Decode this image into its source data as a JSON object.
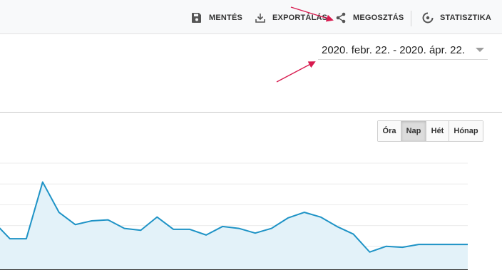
{
  "toolbar": {
    "items": [
      {
        "label": "MENTÉS",
        "icon": "save-icon"
      },
      {
        "label": "EXPORTÁLÁS",
        "icon": "download-icon"
      },
      {
        "label": "MEGOSZTÁS",
        "icon": "share-icon"
      },
      {
        "label": "STATISZTIKA",
        "icon": "insights-icon"
      }
    ]
  },
  "date_range": {
    "text": "2020. febr. 22. - 2020. ápr. 22."
  },
  "granularity": {
    "buttons": [
      "Óra",
      "Nap",
      "Hét",
      "Hónap"
    ],
    "selected": "Nap"
  },
  "colors": {
    "line": "#1e93c6",
    "area": "#e3f2f9",
    "annotation_arrow": "#d81b4f"
  },
  "chart_data": {
    "type": "area",
    "x": [
      1,
      2,
      3,
      4,
      5,
      6,
      7,
      8,
      9,
      10,
      11,
      12,
      13,
      14,
      15,
      16,
      17,
      18,
      19,
      20,
      21,
      22,
      23,
      24,
      25,
      26,
      27,
      28,
      29,
      30
    ],
    "series": [
      {
        "values": [
          48,
          30,
          30,
          90,
          58,
          45,
          49,
          50,
          41,
          39,
          53,
          40,
          40,
          34,
          43,
          41,
          36,
          41,
          52,
          58,
          53,
          43,
          35,
          16,
          22,
          21,
          24,
          24,
          24,
          24
        ]
      }
    ],
    "ylim": [
      0,
      110
    ],
    "grid": true
  }
}
